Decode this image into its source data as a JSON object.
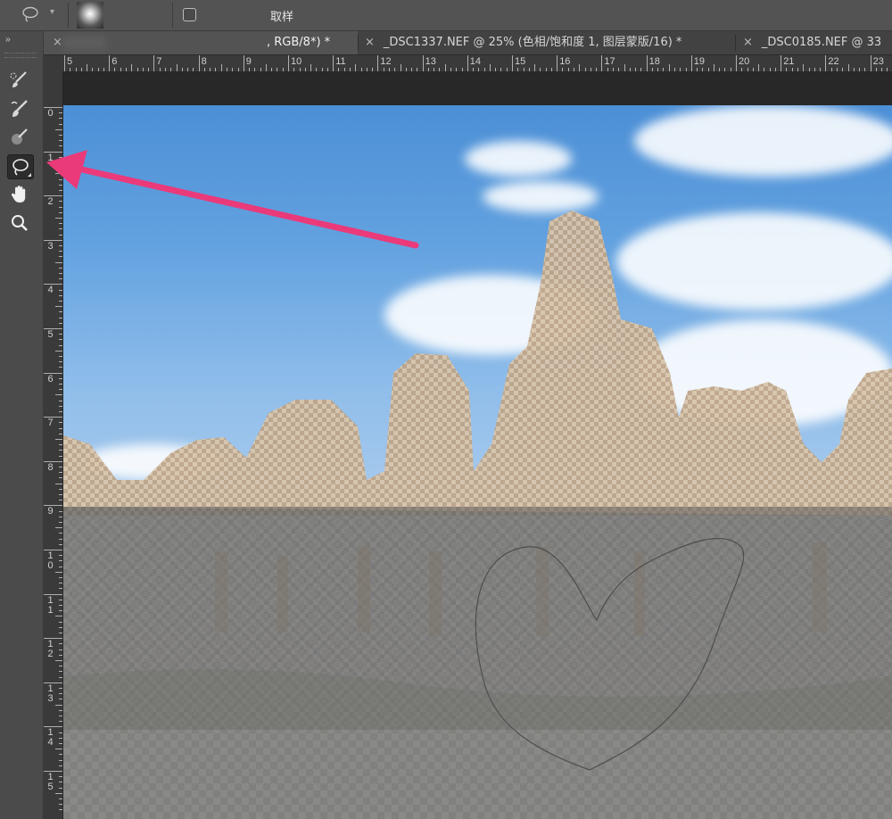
{
  "options_bar": {
    "sample_label": "取样"
  },
  "tabs": [
    {
      "label": ", RGB/8*) *",
      "active": true
    },
    {
      "label": "_DSC1337.NEF @ 25% (色相/饱和度 1, 图层蒙版/16) *",
      "active": false
    },
    {
      "label": "_DSC0185.NEF @ 33",
      "active": false
    }
  ],
  "tab_close_glyph": "×",
  "collapse_glyph": "››",
  "horizontal_ruler": [
    "5",
    "6",
    "7",
    "8",
    "9",
    "10",
    "11",
    "12",
    "13",
    "14",
    "15",
    "16",
    "17",
    "18",
    "19",
    "20",
    "21",
    "22",
    "23"
  ],
  "vertical_ruler": [
    "0",
    "1",
    "2",
    "3",
    "4",
    "5",
    "6",
    "7",
    "8",
    "9",
    "10",
    "11",
    "12",
    "13",
    "14",
    "15"
  ],
  "tools": [
    {
      "name": "quick-selection-brush-icon"
    },
    {
      "name": "mixer-brush-icon"
    },
    {
      "name": "brush-icon"
    },
    {
      "name": "lasso-icon",
      "active": true
    },
    {
      "name": "hand-icon"
    },
    {
      "name": "zoom-icon"
    }
  ],
  "annotation": {
    "arrow_color": "#ea3a7a"
  },
  "colors": {
    "panel": "#4b4b4b",
    "optionsbar": "#535353",
    "accent": "#ea3a7a"
  }
}
